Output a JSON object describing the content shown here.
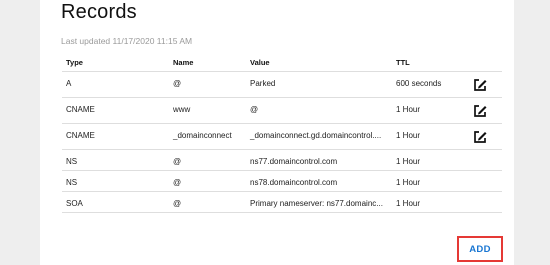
{
  "page": {
    "title": "Records",
    "last_updated": "Last updated 11/17/2020 11:15 AM"
  },
  "table": {
    "headers": [
      "Type",
      "Name",
      "Value",
      "TTL"
    ],
    "rows": [
      {
        "type": "A",
        "name": "@",
        "value": "Parked",
        "ttl": "600 seconds",
        "editable": true
      },
      {
        "type": "CNAME",
        "name": "www",
        "value": "@",
        "ttl": "1 Hour",
        "editable": true
      },
      {
        "type": "CNAME",
        "name": "_domainconnect",
        "value": "_domainconnect.gd.domaincontrol....",
        "ttl": "1 Hour",
        "editable": true
      },
      {
        "type": "NS",
        "name": "@",
        "value": "ns77.domaincontrol.com",
        "ttl": "1 Hour",
        "editable": false
      },
      {
        "type": "NS",
        "name": "@",
        "value": "ns78.domaincontrol.com",
        "ttl": "1 Hour",
        "editable": false
      },
      {
        "type": "SOA",
        "name": "@",
        "value": "Primary nameserver: ns77.domainc...",
        "ttl": "1 Hour",
        "editable": false
      }
    ],
    "edit_icon": "pencil-square-icon"
  },
  "actions": {
    "add_label": "ADD",
    "add_color": "#1976d2",
    "highlight_color": "#e53935"
  }
}
